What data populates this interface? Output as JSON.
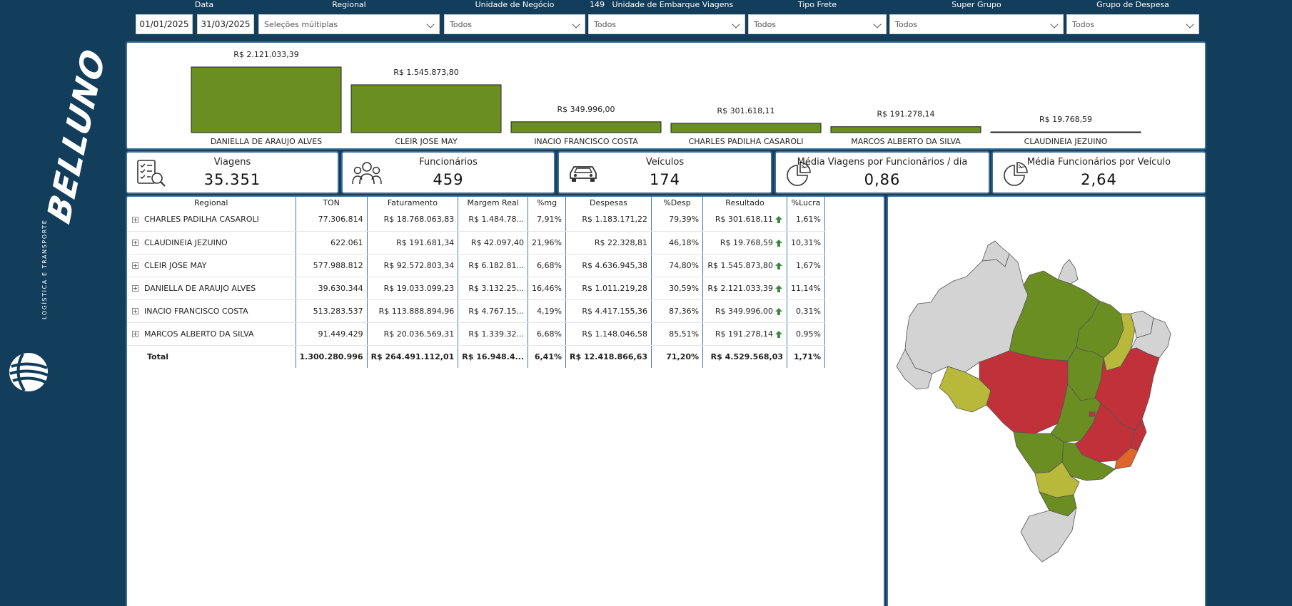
{
  "brand": {
    "name": "BELLUNO",
    "tagline": "LOGÍSTICA E TRANSPORTE"
  },
  "filters": {
    "data": {
      "label": "Data",
      "start": "01/01/2025",
      "end": "31/03/2025"
    },
    "regional": {
      "label": "Regional",
      "value": "Seleções múltiplas"
    },
    "unidade_negocio": {
      "label": "Unidade de Negócio",
      "value": "Todos"
    },
    "unidade_embarque": {
      "count": "149",
      "label": "Unidade de Embarque Viagens",
      "value": "Todos"
    },
    "tipo_frete": {
      "label": "Tipo Frete",
      "value": "Todos"
    },
    "super_grupo": {
      "label": "Super Grupo",
      "value": "Todos"
    },
    "grupo_despesa": {
      "label": "Grupo de Despesa",
      "value": "Todos"
    }
  },
  "chart_data": {
    "type": "bar",
    "categories": [
      "DANIELLA DE ARAUJO ALVES",
      "CLEIR JOSE MAY",
      "INACIO FRANCISCO COSTA",
      "CHARLES PADILHA CASAROLI",
      "MARCOS ALBERTO DA SILVA",
      "CLAUDINEIA JEZUINO"
    ],
    "values": [
      2121033.39,
      1545873.8,
      349996.0,
      301618.11,
      191278.14,
      19768.59
    ],
    "labels": [
      "R$ 2.121.033,39",
      "R$ 1.545.873,80",
      "R$ 349.996,00",
      "R$ 301.618,11",
      "R$ 191.278,14",
      "R$ 19.768,59"
    ],
    "color": "#6b8e23",
    "ylim": [
      0,
      2121033.39
    ]
  },
  "kpis": [
    {
      "label": "Viagens",
      "value": "35.351",
      "icon": "checklist-icon"
    },
    {
      "label": "Funcionários",
      "value": "459",
      "icon": "team-icon"
    },
    {
      "label": "Veículos",
      "value": "174",
      "icon": "car-icon"
    },
    {
      "label": "Média Viagens por Funcionários / dia",
      "value": "0,86",
      "icon": "pie-chart-icon"
    },
    {
      "label": "Média Funcionários por Veículo",
      "value": "2,64",
      "icon": "pie-chart-icon"
    }
  ],
  "table": {
    "headers": [
      "Regional",
      "TON",
      "Faturamento",
      "Margem Real",
      "%mg",
      "Despesas",
      "%Desp",
      "Resultado",
      "%Lucra"
    ],
    "rows": [
      [
        "CHARLES PADILHA CASAROLI",
        "77.306.814",
        "R$ 18.768.063,83",
        "R$ 1.484.78...",
        "7,91%",
        "R$ 1.183.171,22",
        "79,39%",
        "R$ 301.618,11",
        "1,61%"
      ],
      [
        "CLAUDINEIA JEZUINO",
        "622.061",
        "R$ 191.681,34",
        "R$ 42.097,40",
        "21,96%",
        "R$ 22.328,81",
        "46,18%",
        "R$ 19.768,59",
        "10,31%"
      ],
      [
        "CLEIR JOSE MAY",
        "577.988.812",
        "R$ 92.572.803,34",
        "R$ 6.182.81...",
        "6,68%",
        "R$ 4.636.945,38",
        "74,80%",
        "R$ 1.545.873,80",
        "1,67%"
      ],
      [
        "DANIELLA DE ARAUJO ALVES",
        "39.630.344",
        "R$ 19.033.099,23",
        "R$ 3.132.25...",
        "16,46%",
        "R$ 1.011.219,28",
        "30,59%",
        "R$ 2.121.033,39",
        "11,14%"
      ],
      [
        "INACIO FRANCISCO COSTA",
        "513.283.537",
        "R$ 113.888.894,96",
        "R$ 4.767.15...",
        "4,19%",
        "R$ 4.417.155,36",
        "87,36%",
        "R$ 349.996,00",
        "0,31%"
      ],
      [
        "MARCOS ALBERTO DA SILVA",
        "91.449.429",
        "R$ 20.036.569,31",
        "R$ 1.339.32...",
        "6,68%",
        "R$ 1.148.046,58",
        "85,51%",
        "R$ 191.278,14",
        "0,95%"
      ]
    ],
    "total": [
      "Total",
      "1.300.280.996",
      "R$ 264.491.112,01",
      "R$ 16.948.4...",
      "6,41%",
      "R$ 12.418.866,63",
      "71,20%",
      "R$ 4.529.568,03",
      "1,71%"
    ],
    "trend_icon": "arrow-up-icon",
    "trend_color": "#3c8a3c"
  },
  "map": {
    "colors": {
      "green": "#6b8e23",
      "red": "#c0313a",
      "yellow": "#b8b83a",
      "orange": "#e0652a",
      "gray": "#d3d3d3"
    }
  }
}
